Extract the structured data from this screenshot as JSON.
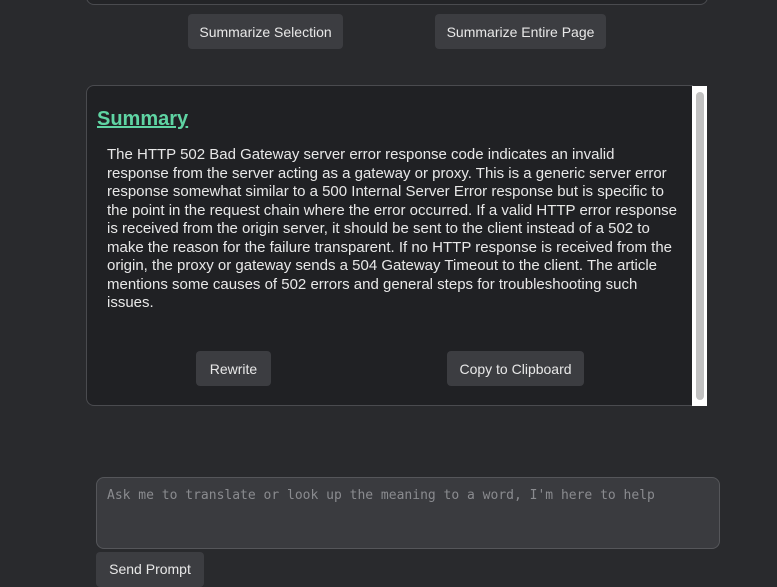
{
  "actions": {
    "summarize_selection_label": "Summarize Selection",
    "summarize_page_label": "Summarize Entire Page"
  },
  "summary": {
    "title": "Summary",
    "text": "The HTTP 502 Bad Gateway server error response code indicates an invalid response from the server acting as a gateway or proxy. This is a generic server error response somewhat similar to a 500 Internal Server Error response but is specific to the point in the request chain where the error occurred. If a valid HTTP error response is received from the origin server, it should be sent to the client instead of a 502 to make the reason for the failure transparent. If no HTTP response is received from the origin, the proxy or gateway sends a 504 Gateway Timeout to the client. The article mentions some causes of 502 errors and general steps for troubleshooting such issues.",
    "rewrite_label": "Rewrite",
    "copy_label": "Copy to Clipboard"
  },
  "prompt": {
    "placeholder": "Ask me to translate or look up the meaning to a word, I'm here to help",
    "value": "",
    "send_label": "Send Prompt"
  },
  "colors": {
    "background": "#292a2d",
    "panel": "#202124",
    "button": "#3c3d41",
    "title_accent": "#5fd4a3",
    "text": "#e8e8e8"
  }
}
